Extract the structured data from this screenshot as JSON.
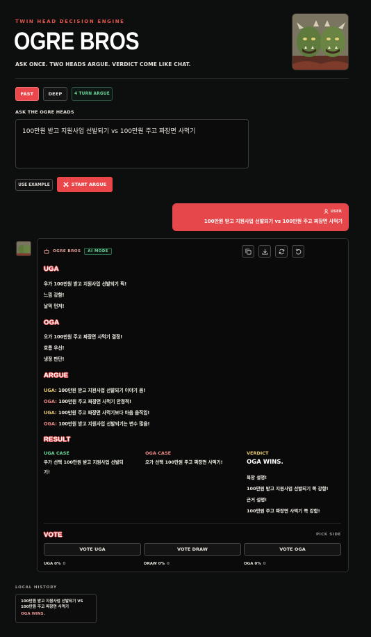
{
  "header": {
    "kicker": "TWIN HEAD DECISION ENGINE",
    "title": "OGRE BROS",
    "tagline": "ASK ONCE. TWO HEADS ARGUE. VERDICT COME LIKE CHAT."
  },
  "modes": {
    "fast_label": "FAST",
    "deep_label": "DEEP",
    "turn_badge": "4 TURN ARGUE"
  },
  "ask": {
    "label": "ASK THE OGRE HEADS",
    "value": "100만원 받고 지원사업 선발되기 vs 100만원 주고 짜장면 사먹기"
  },
  "actions": {
    "example_label": "USE EXAMPLE",
    "start_label": "START ARGUE"
  },
  "user_message": {
    "tag": "USER",
    "text": "100만원 받고 지원사업 선발되기 vs 100만원 주고 짜장면 사먹기"
  },
  "answer": {
    "brand": "OGRE BROS",
    "mode_badge": "AI MODE",
    "toolbar_icons": [
      "copy-icon",
      "download-icon",
      "refresh-icon",
      "undo-icon"
    ],
    "uga": {
      "title": "UGA",
      "lines": [
        "우가 100만원 받고 지원사업 선발되기 픽!",
        "느낌 강함!",
        "날먹 먼저!"
      ]
    },
    "oga": {
      "title": "OGA",
      "lines": [
        "오가 100만원 주고 짜장면 사먹기 결정!",
        "흐름 우선!",
        "냉정 판단!"
      ]
    },
    "argue": {
      "title": "ARGUE",
      "turns": [
        {
          "who": "UGA:",
          "text": "100만원 받고 지원사업 선발되기 이야기 큼!"
        },
        {
          "who": "OGA:",
          "text": "100만원 주고 짜장면 사먹기 안정적!"
        },
        {
          "who": "UGA:",
          "text": "100만원 주고 짜장면 사먹기보다 마음 움직임!"
        },
        {
          "who": "OGA:",
          "text": "100만원 받고 지원사업 선발되기는 변수 많음!"
        }
      ]
    },
    "result": {
      "title": "RESULT",
      "uga_case_label": "UGA CASE",
      "uga_case_lines": [
        "우가 선택 100만원 받고 지원사업 선발되",
        "기!"
      ],
      "oga_case_label": "OGA CASE",
      "oga_case_text": "오가 선택 100만원 주고 짜장면 사먹기!",
      "verdict_label": "VERDICT",
      "verdict": "OGA WINS.",
      "verdict_lines": [
        "욕망 설명!",
        "100만원 받고 지원사업 선발되기 쪽 강함!",
        "근거 설명!",
        "100만원 주고 짜장면 사먹기 쪽 강함!"
      ]
    },
    "vote": {
      "title": "VOTE",
      "hint": "PICK SIDE",
      "buttons": [
        "VOTE UGA",
        "VOTE DRAW",
        "VOTE OGA"
      ],
      "tallies": [
        {
          "label": "UGA 0%",
          "count": "0"
        },
        {
          "label": "DRAW 0%",
          "count": "0"
        },
        {
          "label": "OGA 0%",
          "count": "0"
        }
      ]
    }
  },
  "history": {
    "label": "LOCAL HISTORY",
    "items": [
      {
        "question_lines": [
          "100만원 받고 지원사업 선발되기 VS",
          "100만원 주고 짜장면 사먹기"
        ],
        "verdict": "OGA WINS."
      }
    ]
  },
  "colors": {
    "accent": "#e9474a",
    "uga": "#e6c86a",
    "oga": "#ea8a86",
    "green": "#69d79a",
    "background": "#0d0e0e"
  }
}
